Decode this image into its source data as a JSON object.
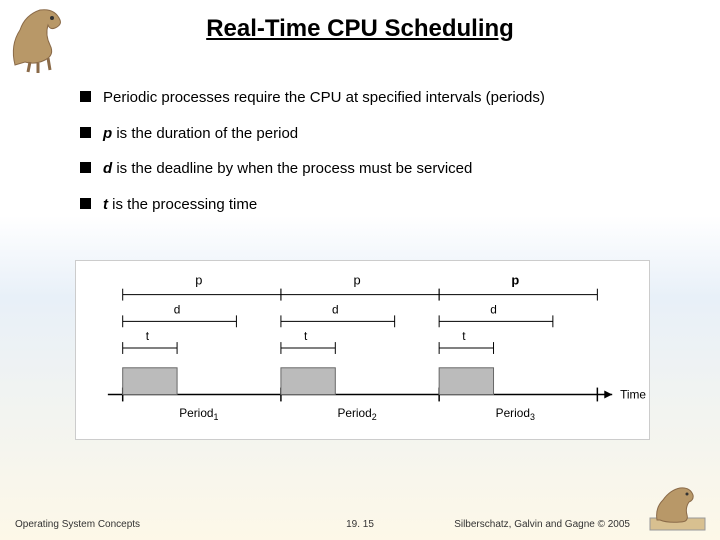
{
  "title": "Real-Time CPU Scheduling",
  "bullets": [
    {
      "prefix": "",
      "italic": "",
      "text": "Periodic processes require the CPU at specified intervals (periods)"
    },
    {
      "prefix": "",
      "italic": "p",
      "text": " is the duration of the period"
    },
    {
      "prefix": "",
      "italic": "d",
      "text": " is the deadline by when the process must be serviced"
    },
    {
      "prefix": "",
      "italic": "t",
      "text": " is the processing time"
    }
  ],
  "diagram": {
    "p_label": "p",
    "d_label": "d",
    "t_label": "t",
    "time_label": "Time",
    "periods": [
      "Period",
      "Period",
      "Period"
    ],
    "period_subs": [
      "1",
      "2",
      "3"
    ]
  },
  "footer": {
    "left": "Operating System Concepts",
    "center": "19. 15",
    "right": "Silberschatz, Galvin and Gagne © 2005"
  }
}
